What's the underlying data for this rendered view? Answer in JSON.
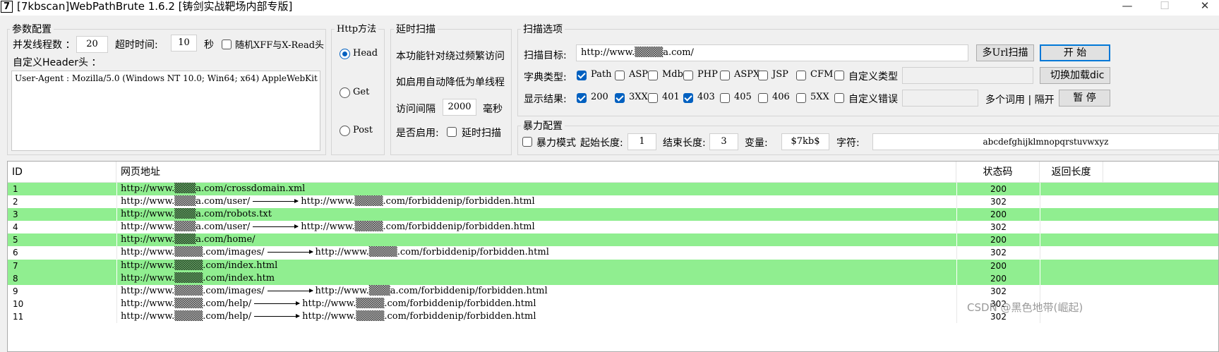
{
  "window": {
    "icon_text": "7",
    "title": "[7kbscan]WebPathBrute 1.6.2 [铸剑实战靶场内部专版]",
    "minimize": "—",
    "maximize": "☐",
    "close": "✕"
  },
  "params": {
    "group_title": "参数配置",
    "threads_label": "并发线程数 ：",
    "threads_value": "20",
    "timeout_label": "超时时间:",
    "timeout_value": "10",
    "timeout_unit": "秒",
    "random_xff_label": "随机XFF与X-Read头",
    "random_xff_checked": false,
    "custom_header_label": "自定义Header头 ：",
    "custom_header_value": "User-Agent : Mozilla/5.0 (Windows NT 10.0; Win64; x64) AppleWebKit"
  },
  "http_method": {
    "group_title": "Http方法",
    "options": [
      {
        "label": "Head",
        "selected": true
      },
      {
        "label": "Get",
        "selected": false
      },
      {
        "label": "Post",
        "selected": false
      }
    ]
  },
  "delay": {
    "group_title": "延时扫描",
    "desc1": "本功能针对绕过频繁访问",
    "desc2": "如启用自动降低为单线程",
    "interval_label": "访问间隔",
    "interval_value": "2000",
    "interval_unit": "毫秒",
    "enable_label": "是否启用:",
    "enable_checkbox_label": "延时扫描",
    "enabled": false
  },
  "scan_options": {
    "group_title": "扫描选项",
    "target_label": "扫描目标:",
    "target_value": "http://www.▒▒▒▒a.com/",
    "multi_url_button": "多Url扫描",
    "start_button": "开 始",
    "dict_label": "字典类型:",
    "dict_types": [
      {
        "label": "Path",
        "checked": true
      },
      {
        "label": "ASP",
        "checked": false
      },
      {
        "label": "Mdb",
        "checked": false
      },
      {
        "label": "PHP",
        "checked": false
      },
      {
        "label": "ASPX",
        "checked": false
      },
      {
        "label": "JSP",
        "checked": false
      },
      {
        "label": "CFM",
        "checked": false
      },
      {
        "label": "自定义类型",
        "checked": false
      }
    ],
    "switch_dict_button": "切换加载dic",
    "show_label": "显示结果:",
    "show_codes": [
      {
        "label": "200",
        "checked": true
      },
      {
        "label": "3XX",
        "checked": true
      },
      {
        "label": "401",
        "checked": false
      },
      {
        "label": "403",
        "checked": true
      },
      {
        "label": "405",
        "checked": false
      },
      {
        "label": "406",
        "checked": false
      },
      {
        "label": "5XX",
        "checked": false
      },
      {
        "label": "自定义错误",
        "checked": false
      }
    ],
    "multi_word_label": "多个词用 | 隔开",
    "pause_button": "暂 停"
  },
  "brute": {
    "group_title": "暴力配置",
    "mode_label": "暴力模式",
    "mode_checked": false,
    "start_len_label": "起始长度:",
    "start_len_value": "1",
    "end_len_label": "结束长度:",
    "end_len_value": "3",
    "var_label": "变量:",
    "var_value": "$7kb$",
    "chars_label": "字符:",
    "chars_value": "abcdefghijklmnopqrstuvwxyz"
  },
  "results": {
    "headers": {
      "id": "ID",
      "url": "网页地址",
      "status": "状态码",
      "length": "返回长度"
    },
    "rows": [
      {
        "id": "1",
        "url": "http://www.▒▒▒a.com/crossdomain.xml",
        "redirect": "",
        "status": "200",
        "highlight": true
      },
      {
        "id": "2",
        "url": "http://www.▒▒▒a.com/user/",
        "redirect": "http://www.▒▒▒▒.com/forbiddenip/forbidden.html",
        "status": "302",
        "highlight": false
      },
      {
        "id": "3",
        "url": "http://www.▒▒▒a.com/robots.txt",
        "redirect": "",
        "status": "200",
        "highlight": true
      },
      {
        "id": "4",
        "url": "http://www.▒▒▒a.com/user/",
        "redirect": "http://www.▒▒▒▒.com/forbiddenip/forbidden.html",
        "status": "302",
        "highlight": false
      },
      {
        "id": "5",
        "url": "http://www.▒▒▒a.com/home/",
        "redirect": "",
        "status": "200",
        "highlight": true
      },
      {
        "id": "6",
        "url": "http://www.▒▒▒▒.com/images/",
        "redirect": "http://www.▒▒▒▒.com/forbiddenip/forbidden.html",
        "status": "302",
        "highlight": false
      },
      {
        "id": "7",
        "url": "http://www.▒▒▒▒.com/index.html",
        "redirect": "",
        "status": "200",
        "highlight": true
      },
      {
        "id": "8",
        "url": "http://www.▒▒▒▒.com/index.htm",
        "redirect": "",
        "status": "200",
        "highlight": true
      },
      {
        "id": "9",
        "url": "http://www.▒▒▒▒.com/images/",
        "redirect": "http://www.▒▒▒a.com/forbiddenip/forbidden.html",
        "status": "302",
        "highlight": false
      },
      {
        "id": "10",
        "url": "http://www.▒▒▒▒.com/help/",
        "redirect": "http://www.▒▒▒▒.com/forbiddenip/forbidden.html",
        "status": "302",
        "highlight": false
      },
      {
        "id": "11",
        "url": "http://www.▒▒▒▒.com/help/",
        "redirect": "http://www.▒▒▒▒.com/forbiddenip/forbidden.html",
        "status": "302",
        "highlight": false
      }
    ]
  },
  "watermark": "CSDN @黑色地带(崛起)"
}
